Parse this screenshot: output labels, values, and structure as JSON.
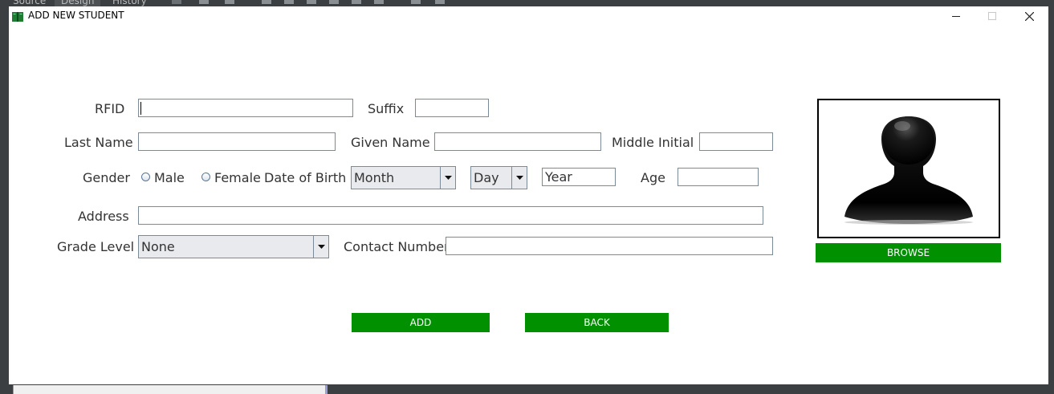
{
  "window": {
    "title": "ADD NEW STUDENT"
  },
  "ide": {
    "tabs": [
      "Source",
      "Design",
      "History"
    ]
  },
  "form": {
    "rfid": {
      "label": "RFID",
      "value": ""
    },
    "suffix": {
      "label": "Suffix",
      "value": ""
    },
    "last_name": {
      "label": "Last Name",
      "value": ""
    },
    "given_name": {
      "label": "Given Name",
      "value": ""
    },
    "middle_initial": {
      "label": "Middle Initial",
      "value": ""
    },
    "gender": {
      "label": "Gender",
      "options": [
        "Male",
        "Female"
      ]
    },
    "dob": {
      "label": "Date of Birth",
      "month": "Month",
      "day": "Day",
      "year": "Year"
    },
    "age": {
      "label": "Age",
      "value": ""
    },
    "address": {
      "label": "Address",
      "value": ""
    },
    "grade_level": {
      "label": "Grade Level",
      "selected": "None"
    },
    "contact_number": {
      "label": "Contact Number",
      "value": ""
    }
  },
  "buttons": {
    "browse": "BROWSE",
    "add": "ADD",
    "back": "BACK"
  },
  "icons": {
    "app": "book-icon",
    "avatar": "user-silhouette-icon",
    "minimize": "minimize-icon",
    "maximize": "maximize-icon",
    "close": "close-icon",
    "dropdown": "chevron-down-icon"
  },
  "colors": {
    "button_bg": "#009000",
    "button_text": "#ffffff",
    "title_icon": "#1e7d32"
  }
}
